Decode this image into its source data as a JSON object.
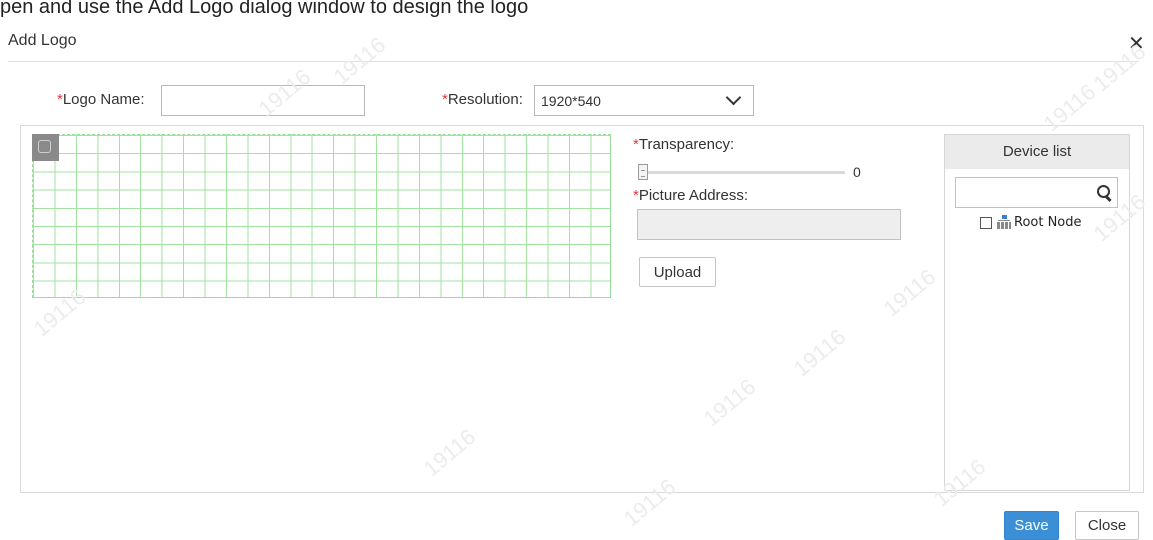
{
  "top_text": "pen and use the Add Logo dialog window to design the logo",
  "dialog": {
    "title": "Add Logo",
    "close_symbol": "✕"
  },
  "form": {
    "required_mark": "*",
    "logo_name_label": "Logo Name:",
    "logo_name_value": "",
    "resolution_label": "Resolution:",
    "resolution_value": "1920*540",
    "transparency_label": "Transparency:",
    "transparency_value": "0",
    "transparency_level": 0,
    "picture_address_label": "Picture Address:",
    "picture_address_value": "",
    "upload_label": "Upload"
  },
  "device_list": {
    "title": "Device list",
    "search_value": "",
    "tree": [
      {
        "label": "Root Node",
        "checked": false,
        "icon": "org-tree-icon"
      }
    ]
  },
  "footer": {
    "save_label": "Save",
    "close_label": "Close"
  },
  "watermark": "19116",
  "colors": {
    "primary": "#3a8fd6",
    "required": "#e4393c",
    "grid": "#9ee29e"
  }
}
